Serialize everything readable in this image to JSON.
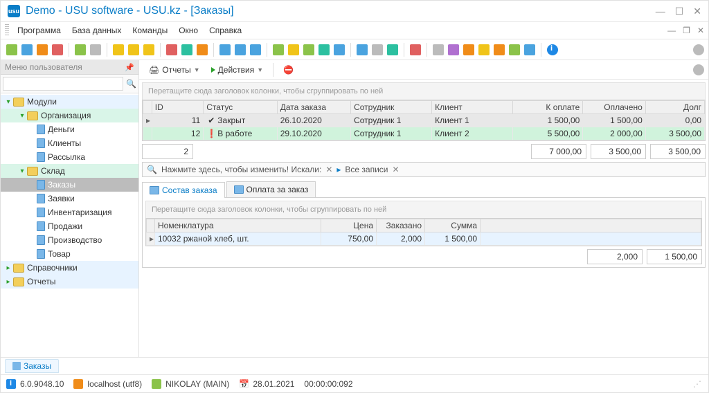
{
  "window": {
    "title": "Demo - USU software - USU.kz - [Заказы]",
    "app_icon_text": "usu"
  },
  "menu": {
    "items": [
      "Программа",
      "База данных",
      "Команды",
      "Окно",
      "Справка"
    ]
  },
  "sidebar": {
    "title": "Меню пользователя",
    "search_placeholder": "",
    "nodes": {
      "modules": "Модули",
      "organization": "Организация",
      "money": "Деньги",
      "clients": "Клиенты",
      "mailing": "Рассылка",
      "warehouse": "Склад",
      "orders": "Заказы",
      "requests": "Заявки",
      "inventory": "Инвентаризация",
      "sales": "Продажи",
      "production": "Производство",
      "goods": "Товар",
      "directories": "Справочники",
      "reports_node": "Отчеты"
    }
  },
  "subtoolbar": {
    "reports": "Отчеты",
    "actions": "Действия"
  },
  "grid": {
    "group_hint": "Перетащите сюда заголовок колонки, чтобы сгруппировать по ней",
    "columns": [
      "ID",
      "Статус",
      "Дата заказа",
      "Сотрудник",
      "Клиент",
      "К оплате",
      "Оплачено",
      "Долг"
    ],
    "rows": [
      {
        "id": "11",
        "status_icon": "✔",
        "status": "Закрыт",
        "date": "26.10.2020",
        "employee": "Сотрудник 1",
        "client": "Клиент 1",
        "to_pay": "1 500,00",
        "paid": "1 500,00",
        "debt": "0,00",
        "row_class": "closed"
      },
      {
        "id": "12",
        "status_icon": "❗",
        "status": "В работе",
        "date": "29.10.2020",
        "employee": "Сотрудник 1",
        "client": "Клиент 2",
        "to_pay": "5 500,00",
        "paid": "2 000,00",
        "debt": "3 500,00",
        "row_class": "active"
      }
    ],
    "footer": {
      "count": "2",
      "to_pay": "7 000,00",
      "paid": "3 500,00",
      "debt": "3 500,00"
    }
  },
  "filter": {
    "hint": "Нажмите здесь, чтобы изменить! Искали:",
    "all_records": "Все записи"
  },
  "detail_tabs": {
    "order_items": "Состав заказа",
    "order_payment": "Оплата за заказ"
  },
  "detail_grid": {
    "group_hint": "Перетащите сюда заголовок колонки, чтобы сгруппировать по ней",
    "columns": [
      "Номенклатура",
      "Цена",
      "Заказано",
      "Сумма"
    ],
    "rows": [
      {
        "name": "10032 ржаной хлеб, шт.",
        "price": "750,00",
        "qty": "2,000",
        "sum": "1 500,00"
      }
    ],
    "footer": {
      "qty": "2,000",
      "sum": "1 500,00"
    }
  },
  "doctab": {
    "label": "Заказы"
  },
  "status": {
    "version": "6.0.9048.10",
    "host": "localhost (utf8)",
    "user": "NIKOLAY (MAIN)",
    "date": "28.01.2021",
    "time": "00:00:00:092"
  }
}
